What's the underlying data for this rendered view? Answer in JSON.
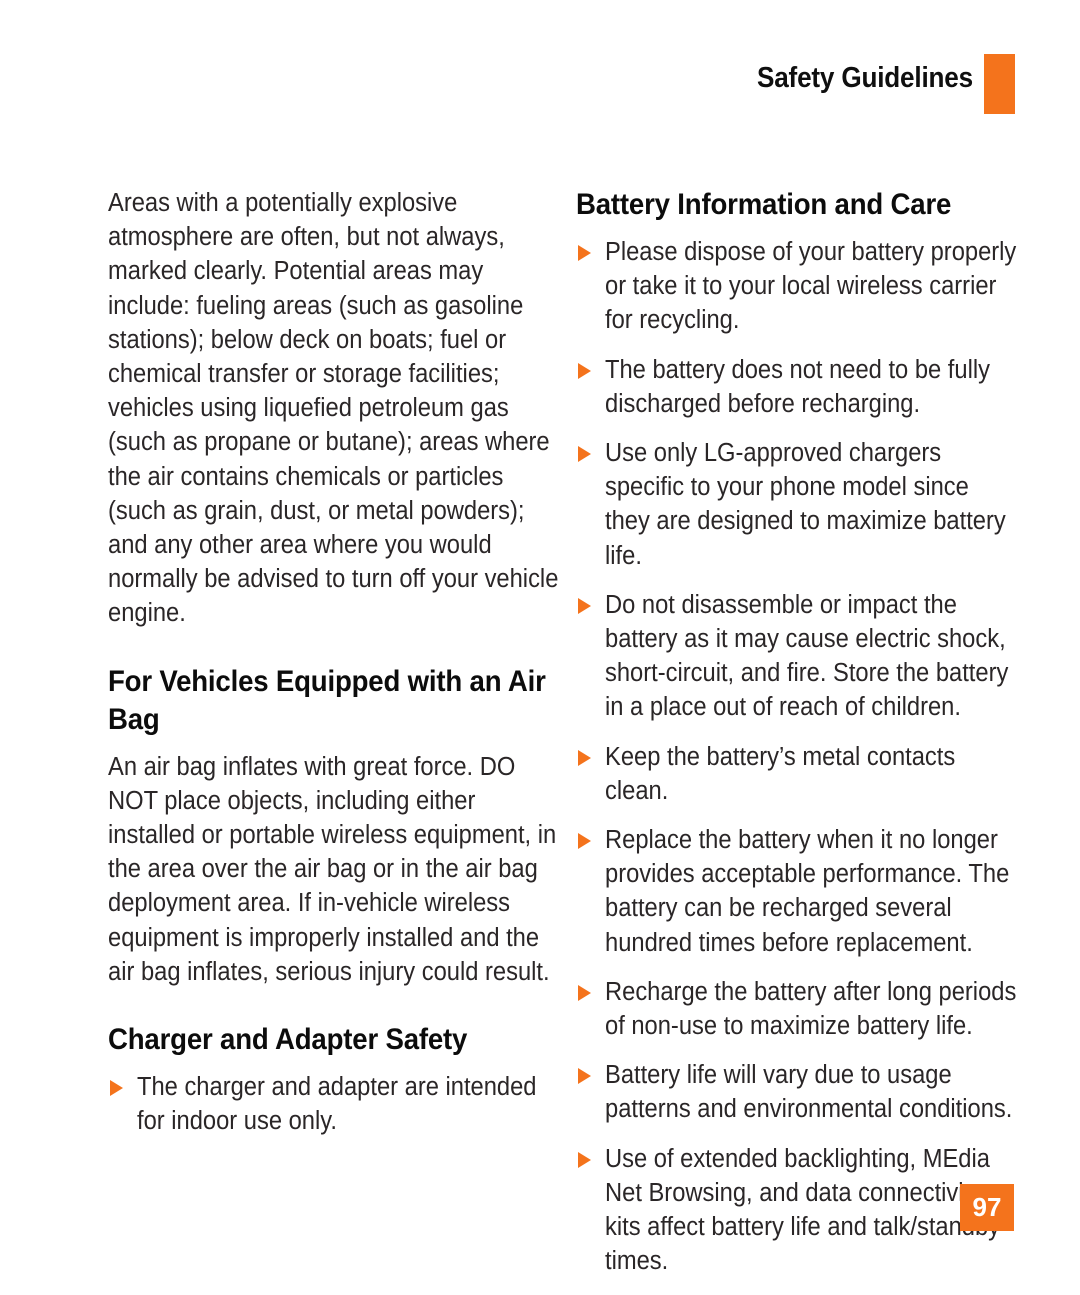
{
  "header": {
    "title": "Safety Guidelines",
    "tab_color": "#F4731C"
  },
  "theme": {
    "accent": "#F4731C",
    "text": "#2a2627",
    "heading": "#0c0c0c",
    "background": "#ffffff"
  },
  "left_column": {
    "intro_paragraph": "Areas with a potentially explosive atmosphere are often, but not always, marked clearly. Potential areas may include: fueling areas (such as gasoline stations); below deck on boats; fuel or chemical transfer or storage facilities; vehicles using liquefied petroleum gas (such as propane or butane); areas where the air contains chemicals or particles (such as grain, dust, or metal powders); and any other area where you would normally be advised to turn off your vehicle engine.",
    "heading_airbag": "For Vehicles Equipped with an Air Bag",
    "airbag_paragraph": "An air bag inflates with great force. DO NOT place objects, including either installed or portable wireless equipment, in the area over the air bag or in the air bag deployment area. If in-vehicle wireless equipment is improperly installed and the air bag inflates, serious injury could result.",
    "heading_charger": "Charger and Adapter Safety",
    "charger_bullets": [
      "The charger and adapter are intended for indoor use only."
    ]
  },
  "right_column": {
    "heading_battery": "Battery Information and Care",
    "battery_bullets": [
      "Please dispose of your battery properly or take it to your local wireless carrier for recycling.",
      "The battery does not need to be fully discharged before recharging.",
      "Use only LG-approved chargers specific to your phone model since they are designed to maximize battery life.",
      "Do not disassemble or impact the battery as it may cause electric shock, short-circuit, and fire. Store the battery in a place out of reach of children.",
      "Keep the battery’s metal contacts clean.",
      "Replace the battery when it no longer provides acceptable performance. The battery can be recharged several hundred times before replacement.",
      "Recharge the battery after long periods of non-use to maximize battery life.",
      "Battery life will vary due to usage patterns and environmental conditions.",
      "Use of extended backlighting, MEdia Net Browsing, and data connectivity kits affect battery life and talk/standby times."
    ]
  },
  "footer": {
    "page_number": "97"
  }
}
